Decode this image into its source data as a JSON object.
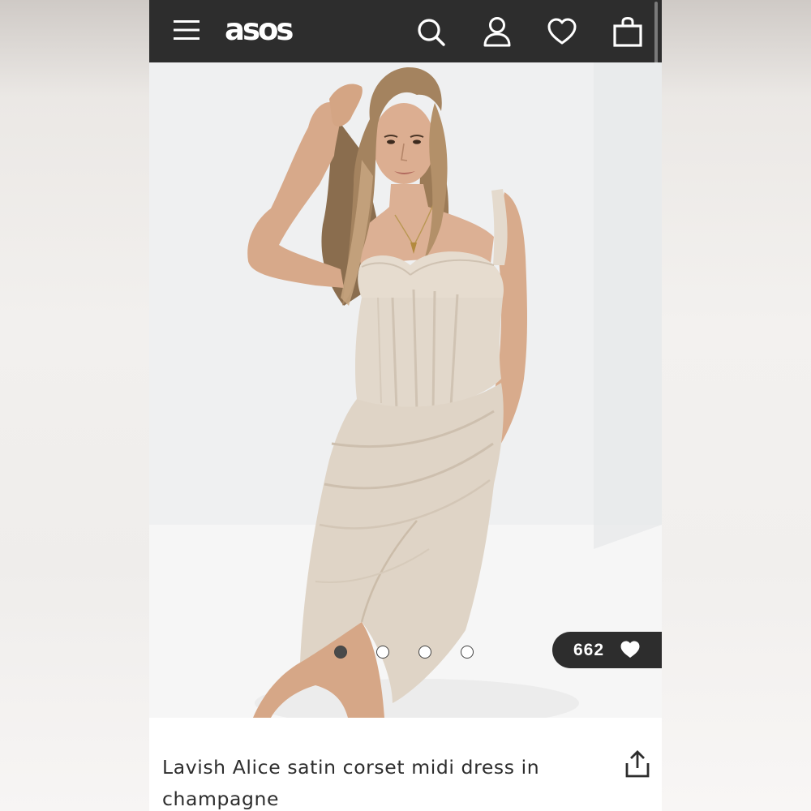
{
  "brand": {
    "logo_text": "asos"
  },
  "header": {
    "icons": [
      "menu-icon",
      "search-icon",
      "account-icon",
      "heart-icon",
      "bag-icon"
    ]
  },
  "gallery": {
    "image_count": 4,
    "active_index": 0,
    "save_count": "662"
  },
  "product": {
    "title": "Lavish Alice satin corset midi dress in champagne"
  },
  "colors": {
    "header_bg": "#2d2d2d",
    "dress": "#e3d9cd",
    "text": "#2d2d2d"
  }
}
